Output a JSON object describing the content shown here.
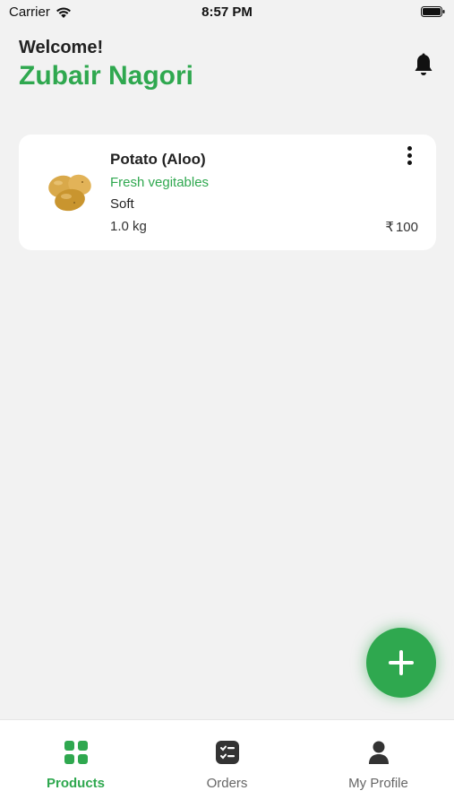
{
  "status_bar": {
    "carrier": "Carrier",
    "time": "8:57 PM"
  },
  "header": {
    "greeting": "Welcome!",
    "user_name": "Zubair Nagori",
    "accent_color": "#2fa84f",
    "notification_icon": "bell-icon"
  },
  "products": [
    {
      "name": "Potato (Aloo)",
      "category": "Fresh vegitables",
      "texture": "Soft",
      "quantity": "1.0 kg",
      "currency_symbol": "₹",
      "price": "100",
      "menu_icon": "more-vertical-icon"
    }
  ],
  "fab": {
    "icon": "plus-icon",
    "color": "#2fa84f"
  },
  "bottom_nav": {
    "items": [
      {
        "label": "Products",
        "icon": "grid-icon",
        "active": true
      },
      {
        "label": "Orders",
        "icon": "checklist-icon",
        "active": false
      },
      {
        "label": "My Profile",
        "icon": "user-icon",
        "active": false
      }
    ]
  }
}
